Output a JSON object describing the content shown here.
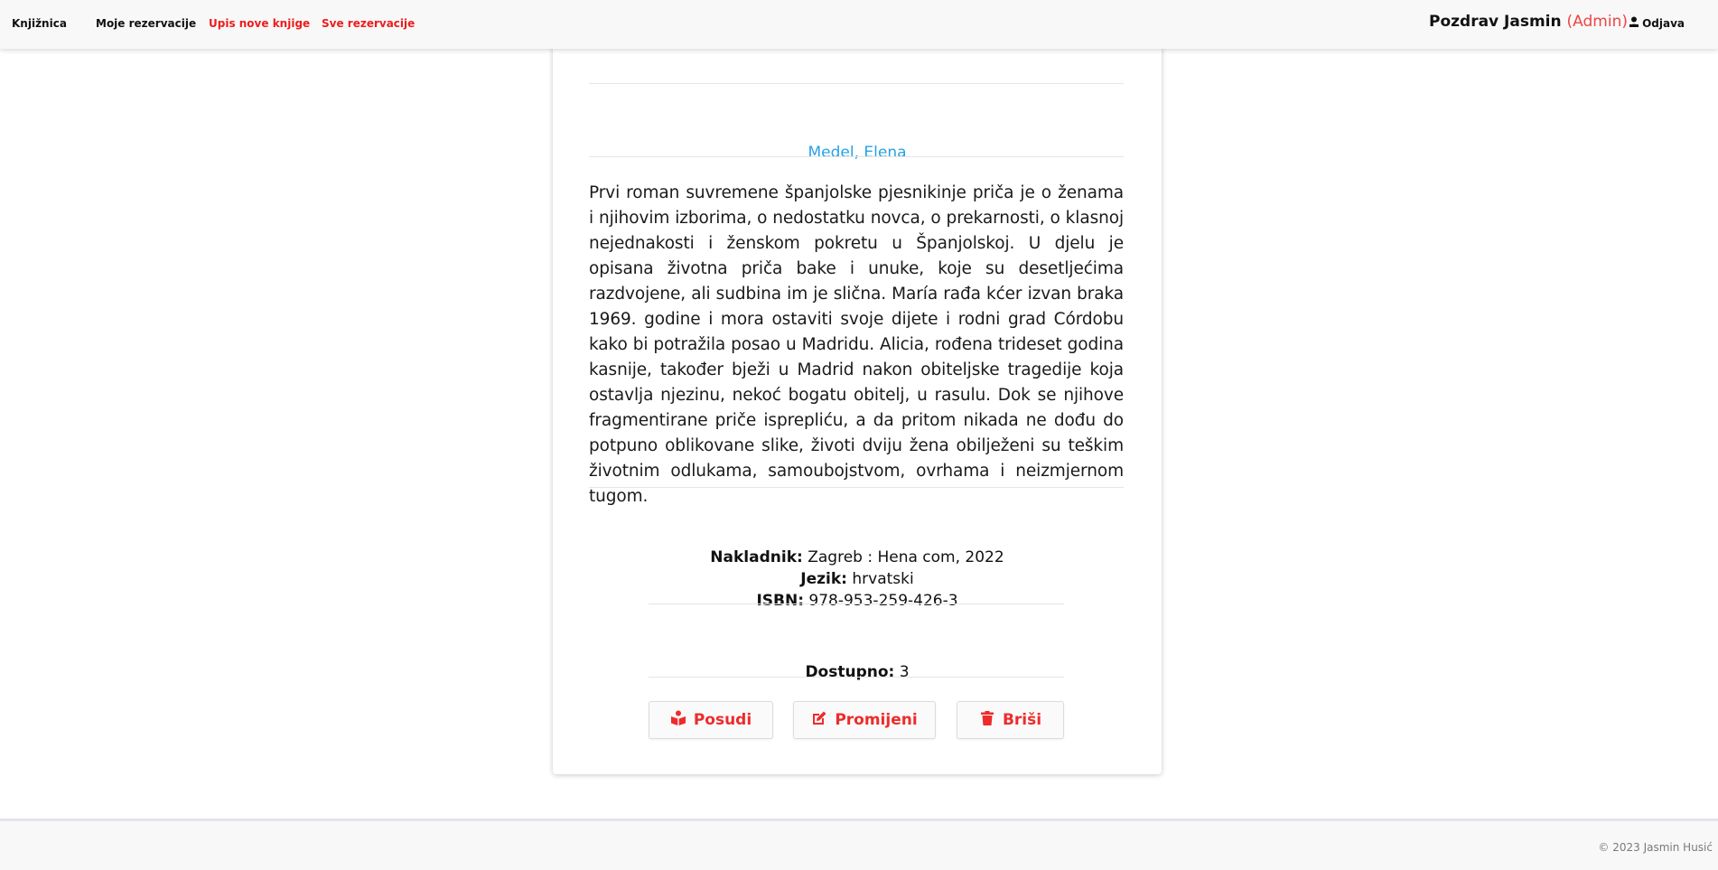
{
  "nav": {
    "brand": "Knjižnica",
    "links": [
      "Moje rezervacije",
      "Upis nove knjige",
      "Sve rezervacije"
    ],
    "greeting": "Pozdrav Jasmin",
    "role": "(Admin)",
    "logout": "Odjava"
  },
  "book": {
    "author": "Medel, Elena",
    "description": "Prvi roman suvremene španjolske pjesnikinje priča je o ženama i njihovim izborima, o nedostatku novca, o prekarnosti, o klasnoj nejednakosti i ženskom pokretu u Španjolskoj. U djelu je opisana životna priča bake i unuke, koje su desetljećima razdvojene, ali sudbina im je slična. María rađa kćer izvan braka 1969. godine i mora ostaviti svoje dijete i rodni grad Córdobu kako bi potražila posao u Madridu. Alicia, rođena trideset godina kasnije, također bježi u Madrid nakon obiteljske tragedije koja ostavlja njezinu, nekoć bogatu obitelj, u rasulu. Dok se njihove fragmentirane priče isprepliću, a da pritom nikada ne dođu do potpuno oblikovane slike, životi dviju žena obilježeni su teškim životnim odlukama, samoubojstvom, ovrhama i neizmjernom tugom.",
    "publisher_label": "Nakladnik:",
    "publisher": "Zagreb : Hena com, 2022",
    "language_label": "Jezik:",
    "language": "hrvatski",
    "isbn_label": "ISBN:",
    "isbn": "978-953-259-426-3",
    "available_label": "Dostupno:",
    "available": "3"
  },
  "actions": {
    "borrow": "Posudi",
    "edit": "Promijeni",
    "delete": "Briši"
  },
  "footer": {
    "copyright": "© 2023 Jasmin Husić"
  },
  "colors": {
    "accent_red": "#ee2b2b",
    "author_blue": "#27a2e3"
  },
  "icons": {
    "logout": "user-icon",
    "borrow": "book-reader-icon",
    "edit": "edit-icon",
    "delete": "trash-icon"
  }
}
